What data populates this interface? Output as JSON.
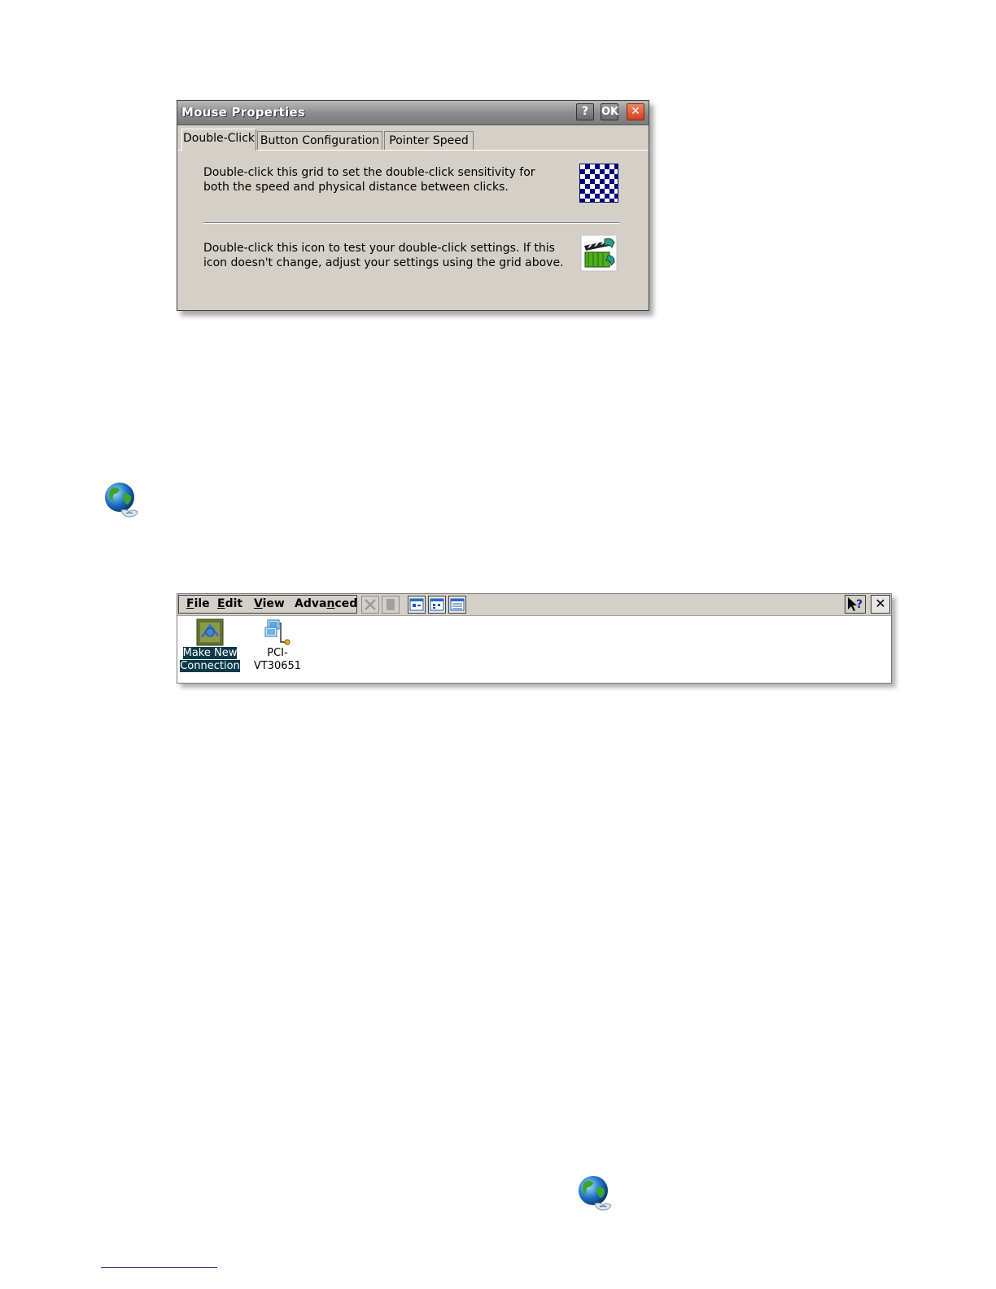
{
  "mouse_dialog": {
    "title": "Mouse Properties",
    "help_btn": "?",
    "ok_btn": "OK",
    "close_btn": "✕",
    "tabs": [
      {
        "label": "Double-Click",
        "active": true
      },
      {
        "label": "Button Configuration",
        "active": false
      },
      {
        "label": "Pointer Speed",
        "active": false
      }
    ],
    "grid_text": "Double-click this grid to set the double-click sensitivity for both the speed and physical distance between clicks.",
    "test_text": "Double-click this icon to test your double-click settings. If this icon doesn't change, adjust your settings using the grid above."
  },
  "connections_window": {
    "menu": [
      {
        "label_pre": "",
        "label_ul": "F",
        "label_post": "ile"
      },
      {
        "label_pre": "",
        "label_ul": "E",
        "label_post": "dit"
      },
      {
        "label_pre": "",
        "label_ul": "V",
        "label_post": "iew"
      },
      {
        "label_pre": "Adva",
        "label_ul": "n",
        "label_post": "ced"
      }
    ],
    "close_btn": "✕",
    "items": [
      {
        "line1": "Make New",
        "line2": "Connection",
        "selected": true
      },
      {
        "line1": "PCI-",
        "line2": "VT30651",
        "selected": false
      }
    ]
  },
  "colors": {
    "checker": "#000080",
    "dialog_bg": "#d4d0c8",
    "selection": "#0a3a4a"
  }
}
